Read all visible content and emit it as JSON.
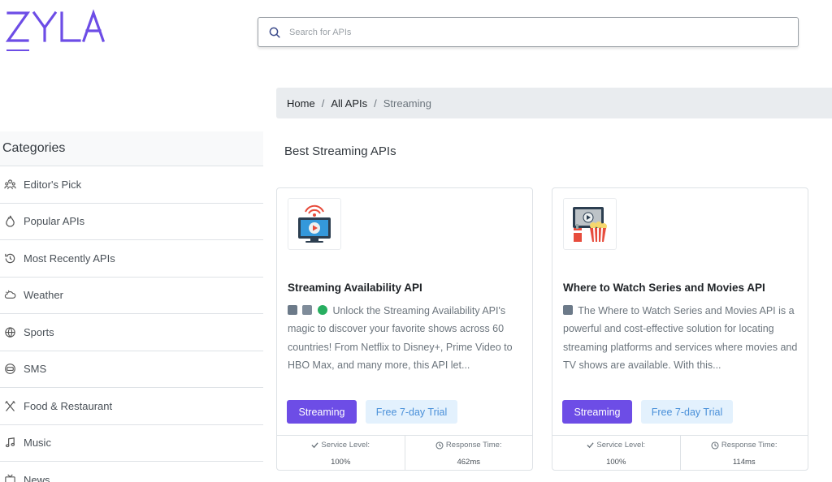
{
  "brand": {
    "logo_text": "ZYLA",
    "accent": "#6d4de6"
  },
  "search": {
    "placeholder": "Search for APIs"
  },
  "breadcrumb": {
    "home": "Home",
    "all": "All APIs",
    "current": "Streaming"
  },
  "sidebar": {
    "title": "Categories",
    "items": [
      {
        "label": "Editor's Pick",
        "icon": "group-icon"
      },
      {
        "label": "Popular APIs",
        "icon": "flame-icon"
      },
      {
        "label": "Most Recently APIs",
        "icon": "history-icon"
      },
      {
        "label": "Weather",
        "icon": "cloud-icon"
      },
      {
        "label": "Sports",
        "icon": "ball-icon"
      },
      {
        "label": "SMS",
        "icon": "sms-icon"
      },
      {
        "label": "Food & Restaurant",
        "icon": "utensils-icon"
      },
      {
        "label": "Music",
        "icon": "music-icon"
      },
      {
        "label": "News",
        "icon": "news-icon"
      }
    ]
  },
  "main": {
    "section_title": "Best Streaming APIs",
    "cards": [
      {
        "title": "Streaming Availability API",
        "description": "Unlock the Streaming Availability API's magic to discover your favorite shows across 60 countries! From Netflix to Disney+, Prime Video to HBO Max, and many more, this API let...",
        "category": "Streaming",
        "trial": "Free 7-day Trial",
        "service_label": "Service Level:",
        "service_value": "100%",
        "response_label": "Response Time:",
        "response_value": "462ms"
      },
      {
        "title": "Where to Watch Series and Movies API",
        "description": "The Where to Watch Series and Movies API is a powerful and cost-effective solution for locating streaming platforms and services where movies and TV shows are available. With this...",
        "category": "Streaming",
        "trial": "Free 7-day Trial",
        "service_label": "Service Level:",
        "service_value": "100%",
        "response_label": "Response Time:",
        "response_value": "114ms"
      }
    ]
  }
}
